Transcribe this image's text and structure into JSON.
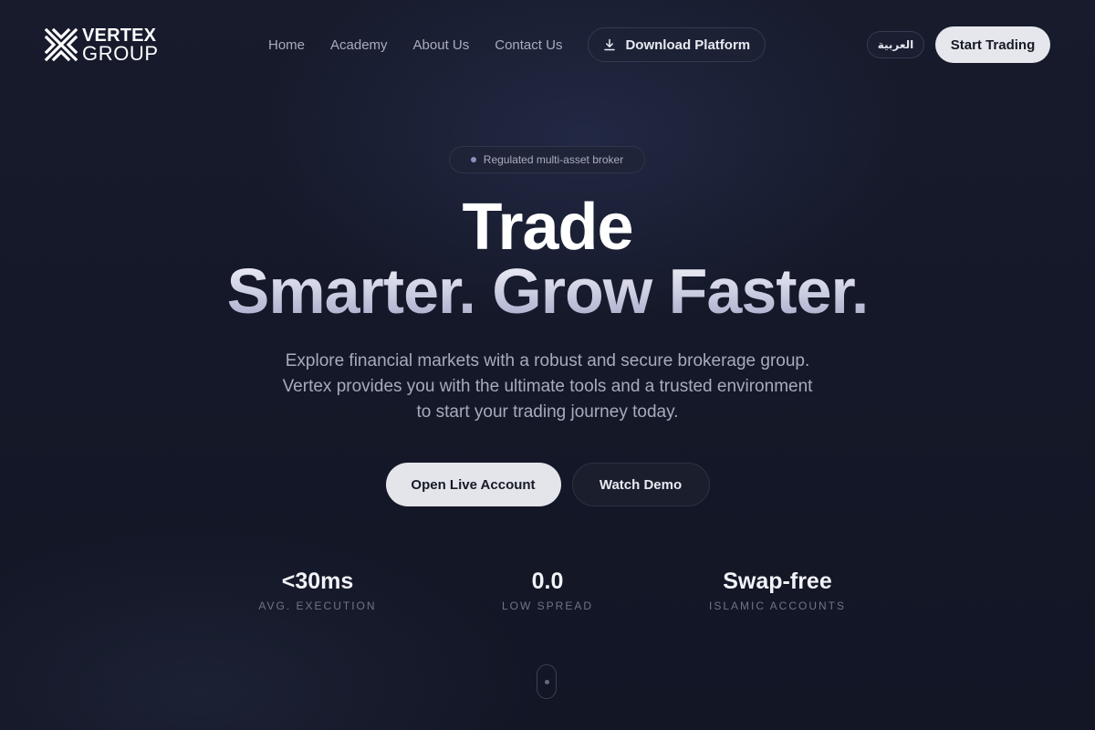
{
  "brand": {
    "name_line1": "VERTEX",
    "name_line2": "GROUP",
    "icon": "vertex-x-logo-mark"
  },
  "nav": {
    "links": [
      "Home",
      "Academy",
      "About Us",
      "Contact Us"
    ],
    "download_label": "Download Platform",
    "download_icon": "download-icon",
    "language_label": "العربية",
    "start_label": "Start Trading"
  },
  "hero": {
    "badge": "Regulated multi-asset broker",
    "headline_line1": "Trade",
    "headline_line2": "Smarter. Grow Faster.",
    "subtext": "Explore financial markets with a robust and secure brokerage group. Vertex provides you with the ultimate tools and a trusted environment to start your trading journey today.",
    "cta_primary": "Open Live Account",
    "cta_secondary": "Watch Demo"
  },
  "stats": [
    {
      "value": "<30ms",
      "label": "Avg. Execution"
    },
    {
      "value": "0.0",
      "label": "Low Spread"
    },
    {
      "value": "Swap-free",
      "label": "Islamic Accounts"
    }
  ],
  "colors": {
    "background": "#121624",
    "primary_button": "#e6e7ec",
    "text_muted": "#a8acbd"
  }
}
